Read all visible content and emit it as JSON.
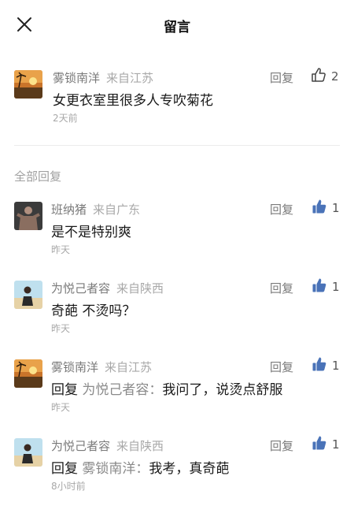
{
  "header": {
    "title": "留言"
  },
  "main_comment": {
    "username": "雾锁南洋",
    "location": "来自江苏",
    "text": "女更衣室里很多人专吹菊花",
    "time": "2天前",
    "reply_label": "回复",
    "likes": "2"
  },
  "section": {
    "label": "全部回复"
  },
  "replies": [
    {
      "username": "班纳猪",
      "location": "来自广东",
      "prefix": "",
      "target": "",
      "text": "是不是特别爽",
      "time": "昨天",
      "reply_label": "回复",
      "likes": "1"
    },
    {
      "username": "为悦己者容",
      "location": "来自陕西",
      "prefix": "",
      "target": "",
      "text": "奇葩 不烫吗？",
      "time": "昨天",
      "reply_label": "回复",
      "likes": "1"
    },
    {
      "username": "雾锁南洋",
      "location": "来自江苏",
      "prefix": "回复 ",
      "target": "为悦己者容：",
      "text": "我问了，说烫点舒服",
      "time": "昨天",
      "reply_label": "回复",
      "likes": "1"
    },
    {
      "username": "为悦己者容",
      "location": "来自陕西",
      "prefix": "回复 ",
      "target": "雾锁南洋：",
      "text": "我考，真奇葩",
      "time": "8小时前",
      "reply_label": "回复",
      "likes": "1"
    }
  ],
  "icons": {
    "close": "close-icon",
    "like_outline": "thumbs-up-outline-icon",
    "like_filled": "thumbs-up-filled-icon"
  },
  "colors": {
    "like_filled": "#4a73b8"
  }
}
